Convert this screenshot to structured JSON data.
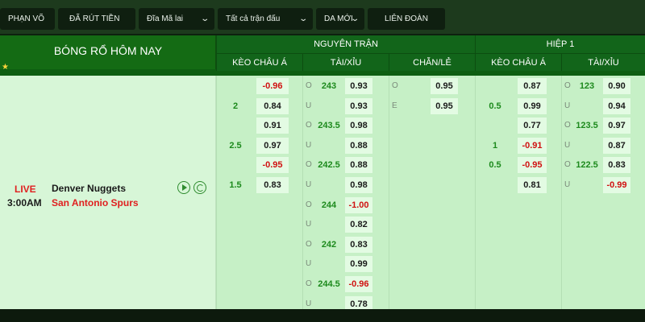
{
  "filters": {
    "f1": "PHẠN VÕ",
    "f2": "ĐÃ RÚT TIỀN",
    "f3": "Đĩa Mã lai",
    "f4": "Tất cả trận đấu",
    "f5": "DA MỚI",
    "f6": "LIÊN ĐOÀN"
  },
  "header": {
    "section_title": "BÓNG RỔ HÔM NAY",
    "group_full": "NGUYÊN TRẬN",
    "group_half": "HIỆP 1",
    "col_handicap": "KÈO CHÂU Á",
    "col_ou": "TÀI/XỈU",
    "col_oe": "CHẴN/LẺ",
    "col_handicap_h1": "KÈO CHÂU Á",
    "col_ou_h1": "TÀI/XỈU"
  },
  "match": {
    "status": "LIVE",
    "time": "3:00AM",
    "home": "Denver Nuggets",
    "away": "San Antonio Spurs"
  },
  "rows": [
    {
      "hc_line": "",
      "hc_odd": "-0.96",
      "ou_side": "O",
      "ou_line": "243",
      "ou_odd": "0.93",
      "oe_side": "O",
      "oe_odd": "0.95",
      "h1hc_line": "",
      "h1hc_odd": "0.87",
      "h1ou_side": "O",
      "h1ou_line": "123",
      "h1ou_odd": "0.90"
    },
    {
      "hc_line": "2",
      "hc_odd": "0.84",
      "ou_side": "U",
      "ou_line": "",
      "ou_odd": "0.93",
      "oe_side": "E",
      "oe_odd": "0.95",
      "h1hc_line": "0.5",
      "h1hc_odd": "0.99",
      "h1ou_side": "U",
      "h1ou_line": "",
      "h1ou_odd": "0.94"
    },
    {
      "hc_line": "",
      "hc_odd": "0.91",
      "ou_side": "O",
      "ou_line": "243.5",
      "ou_odd": "0.98",
      "oe_side": "",
      "oe_odd": "",
      "h1hc_line": "",
      "h1hc_odd": "0.77",
      "h1ou_side": "O",
      "h1ou_line": "123.5",
      "h1ou_odd": "0.97"
    },
    {
      "hc_line": "2.5",
      "hc_odd": "0.97",
      "ou_side": "U",
      "ou_line": "",
      "ou_odd": "0.88",
      "oe_side": "",
      "oe_odd": "",
      "h1hc_line": "1",
      "h1hc_odd": "-0.91",
      "h1ou_side": "U",
      "h1ou_line": "",
      "h1ou_odd": "0.87"
    },
    {
      "hc_line": "",
      "hc_odd": "-0.95",
      "ou_side": "O",
      "ou_line": "242.5",
      "ou_odd": "0.88",
      "oe_side": "",
      "oe_odd": "",
      "h1hc_line": "0.5",
      "h1hc_odd": "-0.95",
      "h1ou_side": "O",
      "h1ou_line": "122.5",
      "h1ou_odd": "0.83"
    },
    {
      "hc_line": "1.5",
      "hc_odd": "0.83",
      "ou_side": "U",
      "ou_line": "",
      "ou_odd": "0.98",
      "oe_side": "",
      "oe_odd": "",
      "h1hc_line": "",
      "h1hc_odd": "0.81",
      "h1ou_side": "U",
      "h1ou_line": "",
      "h1ou_odd": "-0.99"
    },
    {
      "hc_line": "",
      "hc_odd": "",
      "ou_side": "O",
      "ou_line": "244",
      "ou_odd": "-1.00",
      "oe_side": "",
      "oe_odd": "",
      "h1hc_line": "",
      "h1hc_odd": "",
      "h1ou_side": "",
      "h1ou_line": "",
      "h1ou_odd": ""
    },
    {
      "hc_line": "",
      "hc_odd": "",
      "ou_side": "U",
      "ou_line": "",
      "ou_odd": "0.82",
      "oe_side": "",
      "oe_odd": "",
      "h1hc_line": "",
      "h1hc_odd": "",
      "h1ou_side": "",
      "h1ou_line": "",
      "h1ou_odd": ""
    },
    {
      "hc_line": "",
      "hc_odd": "",
      "ou_side": "O",
      "ou_line": "242",
      "ou_odd": "0.83",
      "oe_side": "",
      "oe_odd": "",
      "h1hc_line": "",
      "h1hc_odd": "",
      "h1ou_side": "",
      "h1ou_line": "",
      "h1ou_odd": ""
    },
    {
      "hc_line": "",
      "hc_odd": "",
      "ou_side": "U",
      "ou_line": "",
      "ou_odd": "0.99",
      "oe_side": "",
      "oe_odd": "",
      "h1hc_line": "",
      "h1hc_odd": "",
      "h1ou_side": "",
      "h1ou_line": "",
      "h1ou_odd": ""
    },
    {
      "hc_line": "",
      "hc_odd": "",
      "ou_side": "O",
      "ou_line": "244.5",
      "ou_odd": "-0.96",
      "oe_side": "",
      "oe_odd": "",
      "h1hc_line": "",
      "h1hc_odd": "",
      "h1ou_side": "",
      "h1ou_line": "",
      "h1ou_odd": ""
    },
    {
      "hc_line": "",
      "hc_odd": "",
      "ou_side": "U",
      "ou_line": "",
      "ou_odd": "0.78",
      "oe_side": "",
      "oe_odd": "",
      "h1hc_line": "",
      "h1hc_odd": "",
      "h1ou_side": "",
      "h1ou_line": "",
      "h1ou_odd": ""
    }
  ]
}
